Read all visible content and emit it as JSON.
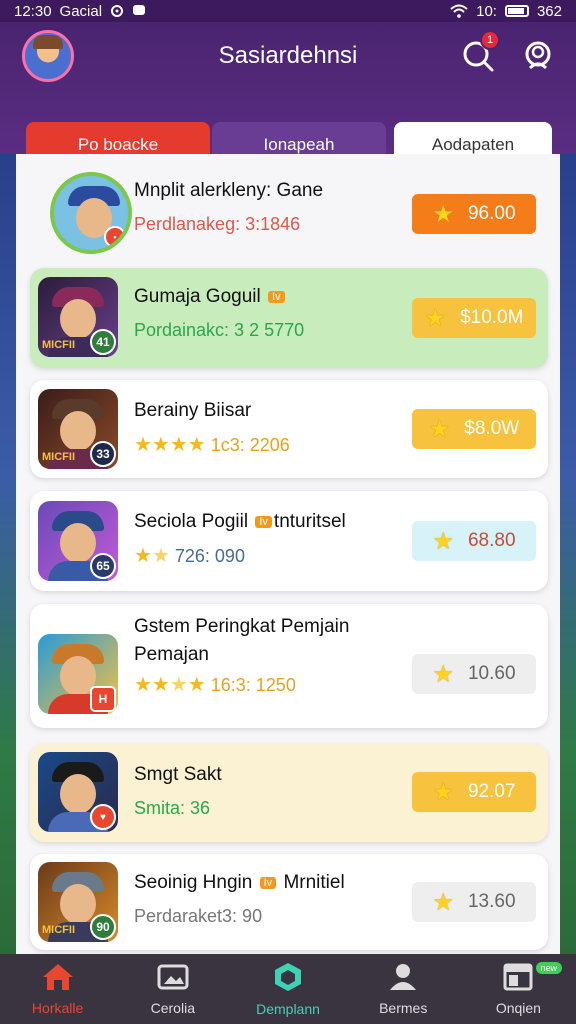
{
  "status": {
    "time": "12:30",
    "carrier": "Gacial",
    "network": "10:",
    "battery": "362"
  },
  "header": {
    "title": "Sasiardehnsi",
    "notif_count": "1"
  },
  "tabs": [
    {
      "label": "Po boacke"
    },
    {
      "label": "Ionapeah"
    },
    {
      "label": "Aodapaten"
    }
  ],
  "rows": [
    {
      "name": "Mnplit alerkleny: Gane",
      "sub": "Perdlanakeg: 3:1846",
      "score": "96.00"
    },
    {
      "name": "Gumaja Goguil",
      "tag": "Iv",
      "sub": "Pordainakc: 3 2 5770",
      "score": "$10.0M",
      "level": "41",
      "badge_text": "MICFII"
    },
    {
      "name": "Berainy Biisar",
      "sub": "1c3: 2206",
      "score": "$8.0W",
      "level": "33",
      "badge_text": "MICFII"
    },
    {
      "name": "Seciola Pogiil",
      "tag": "Iv",
      "name_tail": "tnturitsel",
      "sub": "726: 090",
      "score": "68.80",
      "level": "65"
    },
    {
      "name": "Gstem Peringkat Pemjain",
      "name2": "Pemajan",
      "sub": "16:3: 1250",
      "score": "10.60"
    },
    {
      "name": "Smgt Sakt",
      "sub": "Smita: 36",
      "score": "92.07"
    },
    {
      "name": "Seoinig Hngin",
      "tag": "Iv",
      "name_tail": "Mrnitiel",
      "sub": "Perdaraket3: 90",
      "score": "13.60",
      "level": "90",
      "badge_text": "MICFII"
    }
  ],
  "nav": [
    {
      "label": "Horkalle",
      "icon": "home-icon"
    },
    {
      "label": "Cerolia",
      "icon": "image-icon"
    },
    {
      "label": "Demplann",
      "icon": "hexagon-icon"
    },
    {
      "label": "Bermes",
      "icon": "person-icon"
    },
    {
      "label": "Onqien",
      "icon": "window-icon",
      "badge": "new"
    }
  ],
  "colors": {
    "accent_red": "#e53a2e",
    "purple": "#5a2d82",
    "gold": "#f7c23e",
    "orange": "#f47d1a",
    "teal": "#3fd3b5"
  }
}
